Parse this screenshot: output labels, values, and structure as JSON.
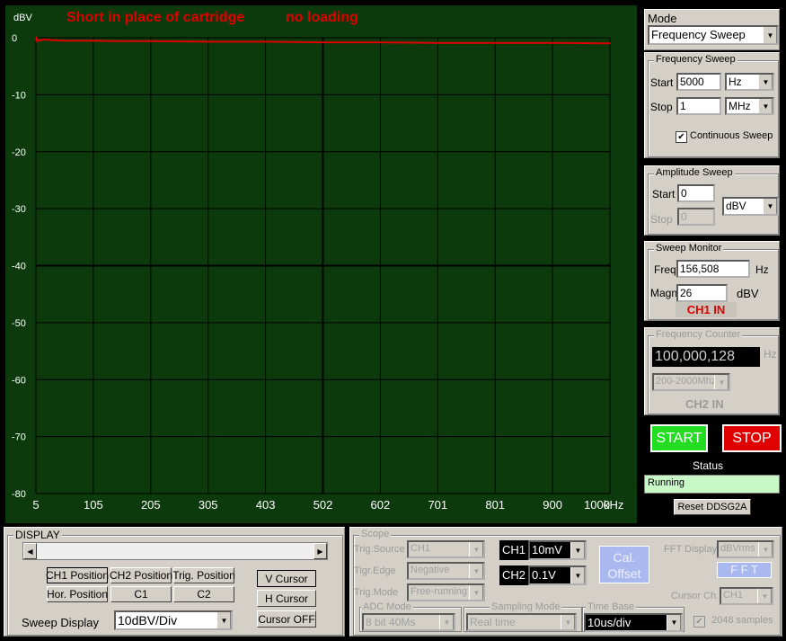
{
  "plot": {
    "y_unit": "dBV",
    "annotation_1": "Short in place of cartridge",
    "annotation_2": "no loading",
    "y_ticks": [
      "0",
      "-10",
      "-20",
      "-30",
      "-40",
      "-50",
      "-60",
      "-70",
      "-80"
    ],
    "x_ticks": [
      "5",
      "105",
      "205",
      "305",
      "403",
      "502",
      "602",
      "701",
      "801",
      "900",
      "1000"
    ],
    "x_unit": "kHz",
    "colors": {
      "background": "#0d3a0d",
      "grid": "#000000",
      "trace": "#e00000"
    }
  },
  "chart_data": {
    "type": "line",
    "xlabel": "kHz",
    "ylabel": "dBV",
    "ylim": [
      -80,
      0
    ],
    "xlim": [
      5,
      1000
    ],
    "grid": true,
    "series": [
      {
        "x": [
          5,
          6,
          7,
          8,
          10,
          12,
          15,
          20,
          30,
          50,
          80,
          105,
          150,
          205,
          305,
          403,
          502,
          602,
          701,
          801,
          900,
          1000
        ],
        "values": [
          -0.5,
          -0.2,
          -0.6,
          -0.3,
          -0.4,
          -0.5,
          -0.4,
          -0.3,
          -0.4,
          -0.5,
          -0.5,
          -0.5,
          -0.6,
          -0.6,
          -0.7,
          -0.7,
          -0.8,
          -0.8,
          -0.9,
          -0.9,
          -0.9,
          -1.0
        ]
      }
    ]
  },
  "mode": {
    "label": "Mode",
    "value": "Frequency Sweep"
  },
  "freq_sweep": {
    "title": "Frequency Sweep",
    "start_label": "Start",
    "start_value": "5000",
    "start_unit": "Hz",
    "stop_label": "Stop",
    "stop_value": "1",
    "stop_unit": "MHz",
    "continuous_label": "Continuous Sweep",
    "continuous_mark": "✔"
  },
  "amp_sweep": {
    "title": "Amplitude Sweep",
    "start_label": "Start",
    "start_value": "0",
    "stop_label": "Stop",
    "stop_value": "0",
    "unit": "dBV"
  },
  "monitor": {
    "title": "Sweep Monitor",
    "freq_label": "Freq",
    "freq_value": "156,508",
    "freq_unit": "Hz",
    "magn_label": "Magn.",
    "magn_value": "26",
    "magn_unit": "dBV",
    "channel": "CH1 IN"
  },
  "counter": {
    "title": "Frequency Counter",
    "value": "100,000,128",
    "unit": "Hz",
    "range": "200-2000Mhz",
    "channel": "CH2 IN"
  },
  "controls": {
    "start": "START",
    "stop": "STOP",
    "status_label": "Status",
    "status_value": "Running",
    "reset": "Reset DDSG2A"
  },
  "display": {
    "title": "DISPLAY",
    "ch1_pos": "CH1 Position",
    "ch2_pos": "CH2 Position",
    "trig_pos": "Trig. Position",
    "hor_pos": "Hor. Position",
    "c1": "C1",
    "c2": "C2",
    "v_cursor": "V Cursor",
    "h_cursor": "H Cursor",
    "cursor_off": "Cursor OFF",
    "sweep_label": "Sweep Display",
    "sweep_value": "10dBV/Div"
  },
  "scope": {
    "title": "Scope",
    "trig_source_label": "Trig.Source",
    "trig_source": "CH1",
    "trig_edge_label": "Tigr.Edge",
    "trig_edge": "Negative",
    "trig_mode_label": "Trig.Mode",
    "trig_mode": "Free-running",
    "adc_label": "ADC Mode",
    "adc_value": "8 bit 40Ms",
    "sampling_label": "Sampling Mode",
    "sampling_value": "Real time",
    "ch1_label": "CH1",
    "ch1_value": "10mV",
    "ch2_label": "CH2",
    "ch2_value": "0.1V",
    "cal_line1": "Cal.",
    "cal_line2": "Offset",
    "timebase_label": "Time Base",
    "timebase_value": "10us/div",
    "fft_label": "FFT Display",
    "fft_value": "dBVrms",
    "fft_button": "F F T",
    "cursor_ch_label": "Cursor Ch.",
    "cursor_ch_value": "CH1",
    "samples_label": "2048 samples",
    "samples_mark": "✔"
  }
}
